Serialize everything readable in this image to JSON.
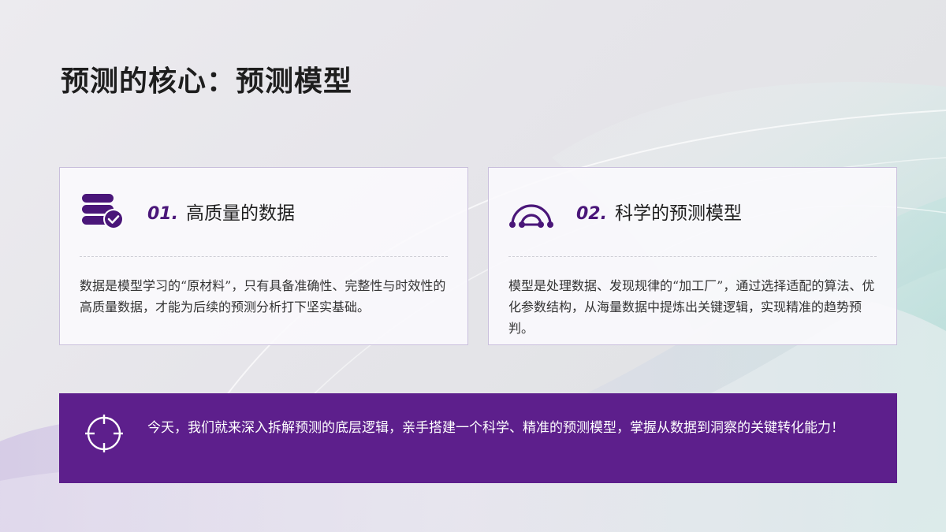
{
  "slide": {
    "title": "预测的核心：预测模型"
  },
  "cards": [
    {
      "number": "01.",
      "title": "高质量的数据",
      "icon": "database-check-icon",
      "body": "数据是模型学习的“原材料”，只有具备准确性、完整性与时效性的高质量数据，才能为后续的预测分析打下坚实基础。"
    },
    {
      "number": "02.",
      "title": "科学的预测模型",
      "icon": "arc-nodes-icon",
      "body": "模型是处理数据、发现规律的“加工厂”，通过选择适配的算法、优化参数结构，从海量数据中提炼出关键逻辑，实现精准的趋势预判。"
    }
  ],
  "banner": {
    "icon": "target-crosshair-icon",
    "text": "今天，我们就来深入拆解预测的底层逻辑，亲手搭建一个科学、精准的预测模型，掌握从数据到洞察的关键转化能力！"
  },
  "colors": {
    "accent": "#5d1f8c",
    "accent_dark": "#4a1679",
    "card_border": "#c9bfdc",
    "title": "#1e1e1e"
  }
}
